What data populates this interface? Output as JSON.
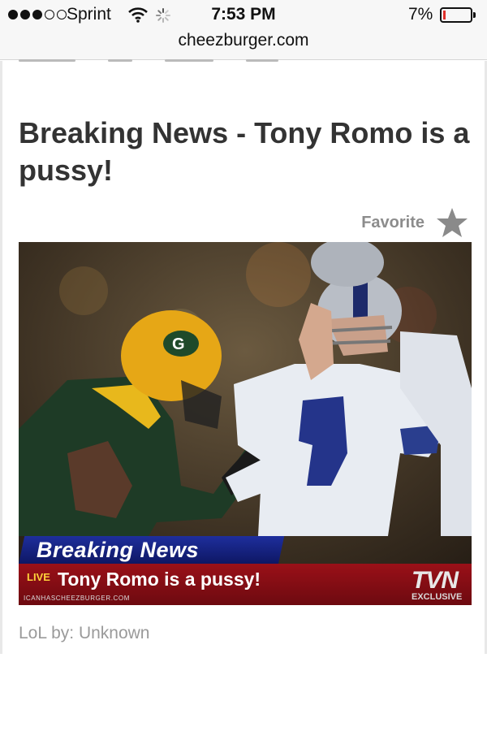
{
  "status_bar": {
    "carrier": "Sprint",
    "time": "7:53 PM",
    "battery_percent": "7%",
    "battery_level": 0.07,
    "signal_bars_filled": 3,
    "signal_bars_total": 5,
    "icons": [
      "wifi-icon",
      "loading-spinner-icon",
      "battery-icon"
    ]
  },
  "browser": {
    "url": "cheezburger.com"
  },
  "article": {
    "title": "Breaking News - Tony Romo is a pussy!",
    "favorite_label": "Favorite",
    "favorite_icon": "star-icon",
    "credit": "LoL by: Unknown"
  },
  "image": {
    "banner_label": "Breaking News",
    "live_label": "LIVE",
    "caption": "Tony Romo is a pussy!",
    "site_watermark": "ICANHASCHEEZBURGER.COM",
    "network_logo": "TVN",
    "network_tag": "EXCLUSIVE"
  },
  "colors": {
    "banner_blue": "#1e2e9c",
    "ticker_red": "#8a0e16",
    "live_yellow": "#ffd23a",
    "title_text": "#333333",
    "muted_text": "#9a9a9a"
  }
}
